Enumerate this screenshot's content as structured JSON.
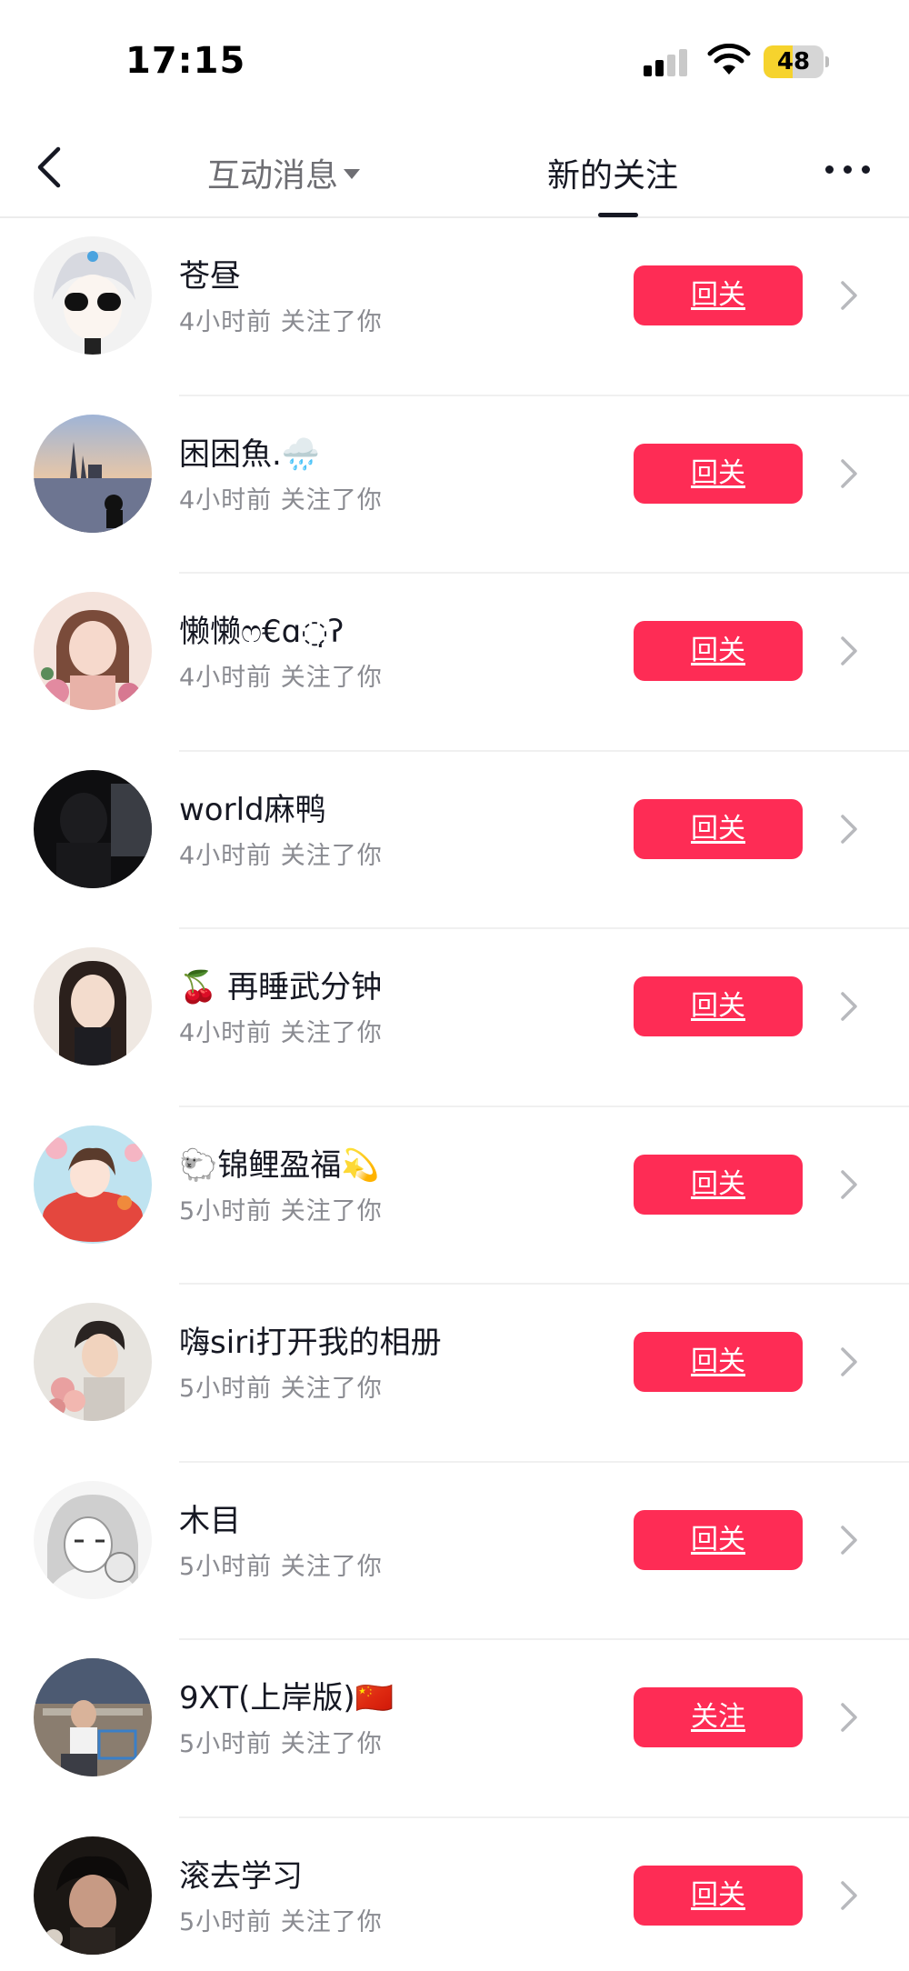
{
  "status_bar": {
    "time": "17:15",
    "battery": "48",
    "battery_level": 0.48,
    "signal_bars": 2
  },
  "nav": {
    "back_icon": "chevron-left-icon",
    "tab_interactions": "互动消息",
    "tab_new_follows": "新的关注",
    "active_tab": "新的关注",
    "more_icon": "more-dots-icon"
  },
  "colors": {
    "accent": "#fe2c55",
    "primary_text": "#161823",
    "secondary_text": "#8a8b91",
    "battery": "#f6d32d"
  },
  "follows": [
    {
      "name": "苍昼",
      "meta": "4小时前 关注了你",
      "action": "回关"
    },
    {
      "name": "困困魚.🌧️",
      "meta": "4小时前 关注了你",
      "action": "回关"
    },
    {
      "name": "懒懒ෆ€ɑ◌̣ʔ",
      "meta": "4小时前 关注了你",
      "action": "回关"
    },
    {
      "name": "world麻鸭",
      "meta": "4小时前 关注了你",
      "action": "回关"
    },
    {
      "name": "🍒 再睡武分钟",
      "meta": "4小时前 关注了你",
      "action": "回关"
    },
    {
      "name": "🐑锦鲤盈福💫",
      "meta": "5小时前 关注了你",
      "action": "回关"
    },
    {
      "name": "嗨siri打开我的相册",
      "meta": "5小时前 关注了你",
      "action": "回关"
    },
    {
      "name": "木目",
      "meta": "5小时前 关注了你",
      "action": "回关"
    },
    {
      "name": "9XT(上岸版)🇨🇳",
      "meta": "5小时前 关注了你",
      "action": "关注"
    },
    {
      "name": "滚去学习",
      "meta": "5小时前 关注了你",
      "action": "回关"
    }
  ]
}
